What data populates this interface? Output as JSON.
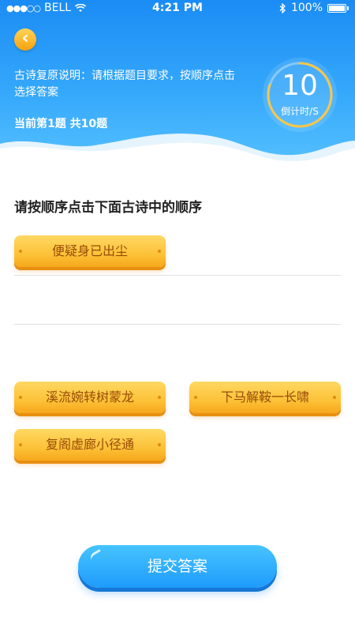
{
  "status_bar": {
    "carrier": "BELL",
    "time": "4:21 PM",
    "battery": "100%"
  },
  "header": {
    "instruction": "古诗复原说明：请根据题目要求，按顺序点击选择答案",
    "progress": "当前第1题 共10题",
    "countdown": {
      "value": "10",
      "label": "倒计时/S",
      "fraction": 0.8
    }
  },
  "question": "请按顺序点击下面古诗中的顺序",
  "answer_slots": [
    {
      "text": "便疑身已出尘"
    }
  ],
  "options": [
    {
      "text": "溪流婉转树蒙龙"
    },
    {
      "text": "下马解鞍一长啸"
    },
    {
      "text": "复阁虚廊小径通"
    }
  ],
  "submit_label": "提交答案",
  "colors": {
    "header_blue": "#1a8cf5",
    "chip_yellow": "#fcc238",
    "button_blue": "#1f9bfb"
  }
}
